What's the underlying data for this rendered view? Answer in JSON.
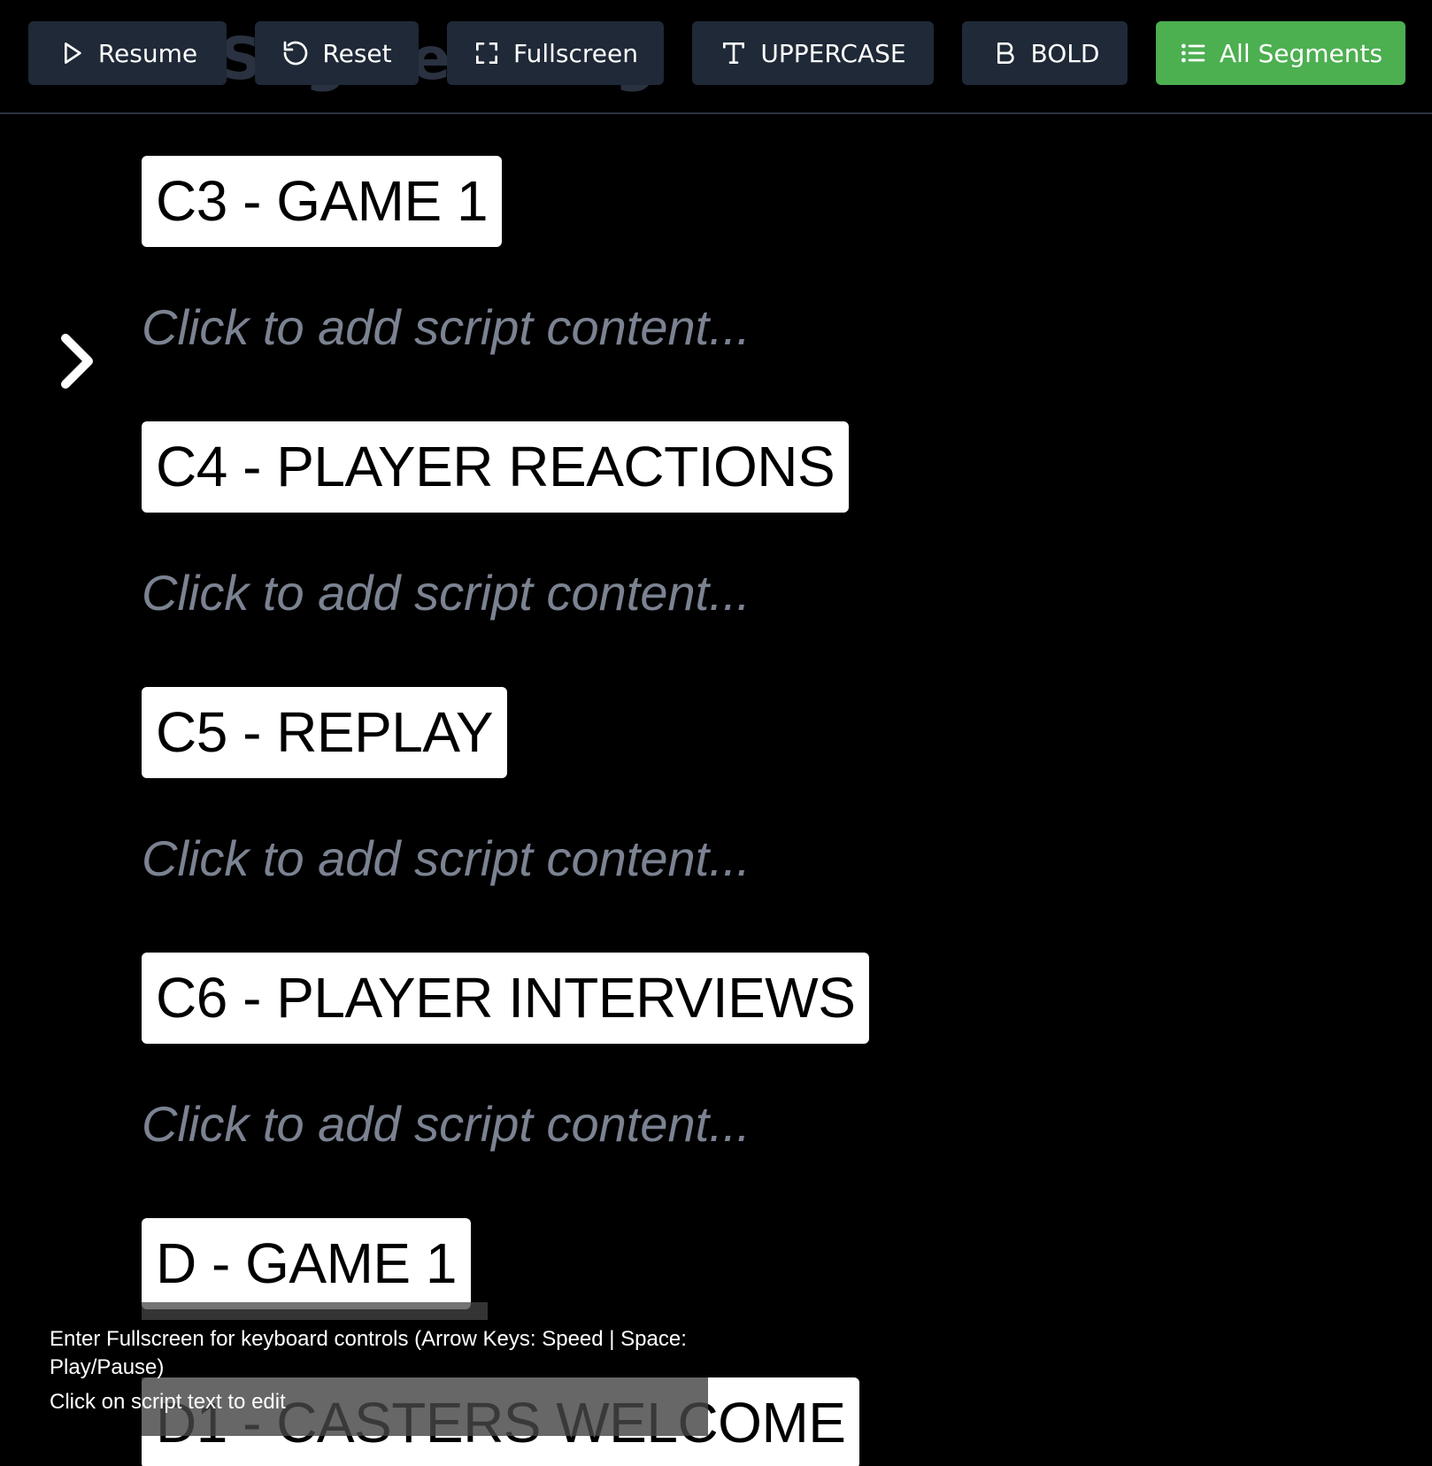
{
  "toolbar": {
    "ghost_title": "Segment Ing",
    "buttons": {
      "resume": {
        "label": "Resume",
        "icon": "play-icon"
      },
      "reset": {
        "label": "Reset",
        "icon": "rotate-ccw-icon"
      },
      "fullscreen": {
        "label": "Fullscreen",
        "icon": "fullscreen-icon"
      },
      "uppercase": {
        "label": "UPPERCASE",
        "icon": "type-icon"
      },
      "bold": {
        "label": "BOLD",
        "icon": "bold-icon"
      },
      "segments": {
        "label": "All Segments",
        "icon": "list-icon"
      }
    },
    "accent": "#4caf50"
  },
  "cue": {
    "icon": "chevron-right-icon"
  },
  "segments": [
    {
      "title": "C3 - GAME 1",
      "body": "Click to add script content..."
    },
    {
      "title": "C4 - PLAYER REACTIONS",
      "body": "Click to add script content..."
    },
    {
      "title": "C5 - REPLAY",
      "body": "Click to add script content..."
    },
    {
      "title": "C6 - PLAYER INTERVIEWS",
      "body": "Click to add script content..."
    },
    {
      "title": "D - GAME 1",
      "body": ""
    },
    {
      "title": "D1 - CASTERS WELCOME",
      "body": ""
    }
  ],
  "help": {
    "line1": "Enter Fullscreen for keyboard controls (Arrow Keys: Speed | Space: Play/Pause)",
    "line2": "Click on script text to edit"
  }
}
